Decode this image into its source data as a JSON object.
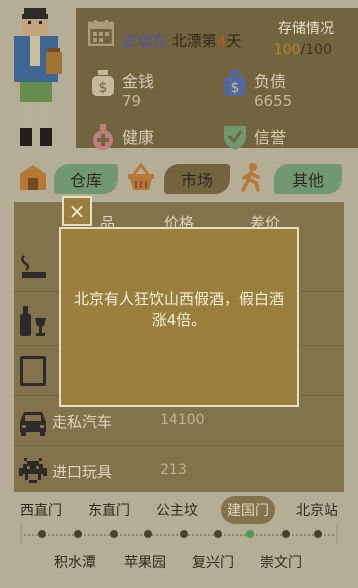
{
  "header": {
    "player_name": "史瑞克",
    "place_prefix": "北漂第",
    "day": "4",
    "day_suffix": "天",
    "storage_label": "存储情况",
    "storage_used": "100",
    "storage_sep": "/",
    "storage_capacity": "100"
  },
  "stats": {
    "money_label": "金钱",
    "money_value": "79",
    "debt_label": "负债",
    "debt_value": "6655",
    "health_label": "健康",
    "reputation_label": "信誉"
  },
  "tabs": {
    "warehouse": "仓库",
    "market": "市场",
    "other": "其他"
  },
  "goods": {
    "columns": [
      "品",
      "价格",
      "差价"
    ],
    "rows": [
      {
        "name": "走私汽车",
        "price": "14100",
        "icon": "car-icon"
      },
      {
        "name": "进口玩具",
        "price": "213",
        "icon": "space-invader-icon"
      }
    ]
  },
  "modal": {
    "message": "北京有人狂饮山西假酒，假白酒涨4倍。",
    "close_label": "×"
  },
  "subway": {
    "top_stations": [
      "西直门",
      "东直门",
      "公主坟",
      "建国门",
      "北京站"
    ],
    "bottom_stations": [
      "积水潭",
      "苹果园",
      "复兴门",
      "崇文门"
    ],
    "active_station": "建国门"
  },
  "colors": {
    "accent_green": "#79a77b",
    "panel_brown": "#7a6b42",
    "modal_gold": "#9a7e3d"
  }
}
